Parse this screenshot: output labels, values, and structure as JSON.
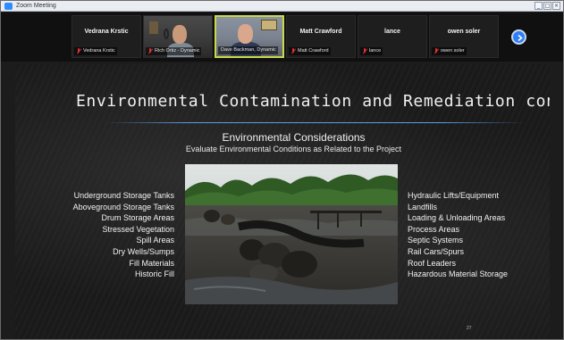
{
  "window": {
    "title": "Zoom Meeting",
    "buttons": [
      "_",
      "□",
      "×"
    ]
  },
  "participants": [
    {
      "name": "Vedrana Krstic",
      "label": "Vedrana Krstic",
      "muted": true,
      "video": false
    },
    {
      "name": "",
      "label": "Rich Ortiz - Dynamic",
      "muted": true,
      "video": true
    },
    {
      "name": "",
      "label": "Dave Backman, Dynamic",
      "muted": false,
      "video": true,
      "speaking": true
    },
    {
      "name": "Matt Crawford",
      "label": "Matt Crawford",
      "muted": true,
      "video": false
    },
    {
      "name": "lance",
      "label": "lance",
      "muted": true,
      "video": false
    },
    {
      "name": "owen soler",
      "label": "owen soler",
      "muted": true,
      "video": false
    }
  ],
  "slide": {
    "title": "Environmental Contamination and Remediation cont.",
    "subtitle": "Environmental Considerations",
    "subtitle2": "Evaluate Environmental Conditions as Related to the Project",
    "left_items": [
      "Underground Storage Tanks",
      "Aboveground Storage Tanks",
      "Drum Storage Areas",
      "Stressed Vegetation",
      "Spill Areas",
      "Dry Wells/Sumps",
      "Fill Materials",
      "Historic Fill"
    ],
    "right_items": [
      "Hydraulic Lifts/Equipment",
      "Landfills",
      "Loading & Unloading Areas",
      "Process Areas",
      "Septic Systems",
      "Rail Cars/Spurs",
      "Roof Leaders",
      "Hazardous Material Storage"
    ],
    "page_number": "27"
  },
  "colors": {
    "accent": "#2d7ff9",
    "speaking_border": "#c9d94a",
    "muted_icon": "#e03131",
    "rule": "#5aa0e6"
  },
  "icons": {
    "next_page": "chevron-right-icon",
    "muted": "mic-muted-icon",
    "app": "zoom-app-icon"
  }
}
